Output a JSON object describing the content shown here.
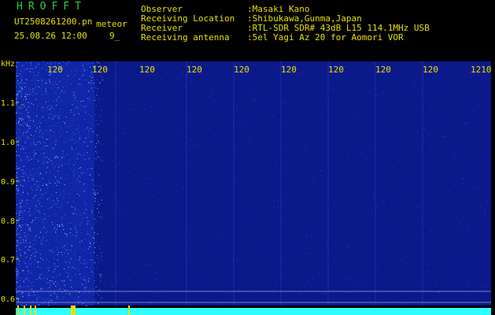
{
  "header": {
    "logo": "HROFFT",
    "filename": "UT2508261200.pn",
    "mode": "meteor",
    "datetime": "25.08.26 12:00",
    "count": "9_",
    "info": [
      {
        "key": "Observer",
        "value": ":Masaki Kano"
      },
      {
        "key": "Receiving Location",
        "value": ":Shibukawa,Gunma,Japan"
      },
      {
        "key": "Receiver",
        "value": ":RTL-SDR SDR# 43dB L15 114.1MHz USB"
      },
      {
        "key": "Receiving antenna",
        "value": ":5el Yagi Az 20 for Aomori VOR"
      }
    ]
  },
  "axes": {
    "y_unit": "kHz",
    "y_ticks": [
      "1.1",
      "1.0",
      "0.9",
      "0.8",
      "0.7",
      "0.6"
    ],
    "x_ticks": [
      "120",
      "120",
      "120",
      "120",
      "120",
      "120",
      "120",
      "120",
      "120",
      "120",
      "1210"
    ]
  },
  "colors": {
    "background": "#000000",
    "waterfall_base": "#0b1a8a",
    "noise_hot": "#7fd8ff",
    "label_yellow": "#e8e000",
    "label_cyan": "#30ffff",
    "logo_green": "#28d040",
    "baseline": "#30ffff"
  }
}
